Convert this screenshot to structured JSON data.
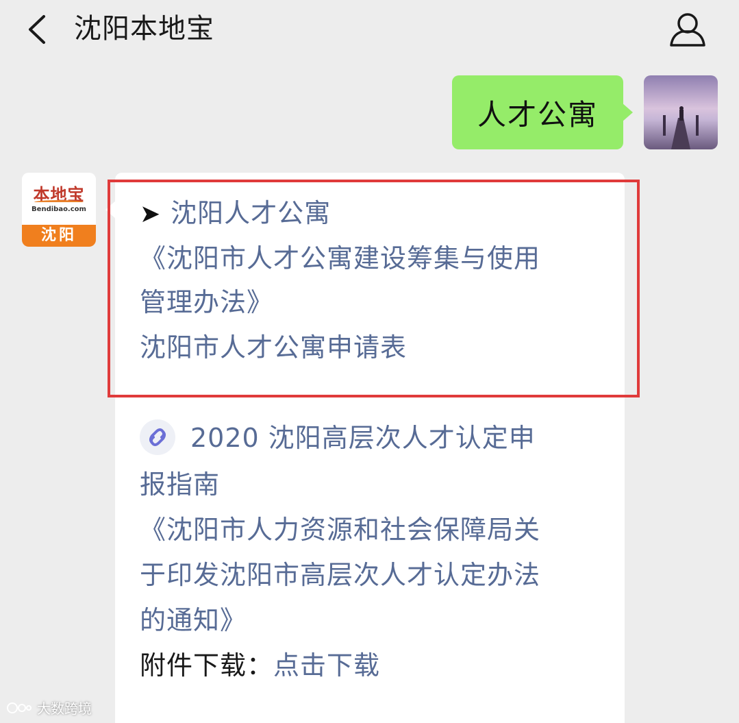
{
  "header": {
    "title": "沈阳本地宝"
  },
  "outgoing": {
    "text": "人才公寓"
  },
  "bot_avatar": {
    "logo_text": "本地宝",
    "logo_sub": "Bendibao.com",
    "city": "沈阳"
  },
  "incoming": {
    "line1_arrow": "➤",
    "line1": "沈阳人才公寓",
    "line2": "《沈阳市人才公寓建设筹集与使用",
    "line3": "管理办法》",
    "line4": "沈阳市人才公寓申请表",
    "line5": "2020 沈阳高层次人才认定申",
    "line6": "报指南",
    "line7": "《沈阳市人力资源和社会保障局关",
    "line8": "于印发沈阳市高层次人才认定办法",
    "line9": "的通知》",
    "line10_prefix": "附件下载：",
    "line10_link": "点击下载"
  },
  "watermark": {
    "text": "大数跨境"
  },
  "colors": {
    "background": "#ededed",
    "outgoing_bubble": "#95ec69",
    "link": "#576b95",
    "highlight_border": "#e03b3b",
    "bot_orange": "#f07f1e"
  },
  "icons": {
    "back": "chevron-left-icon",
    "profile": "person-icon",
    "mini_program": "mini-program-icon"
  }
}
